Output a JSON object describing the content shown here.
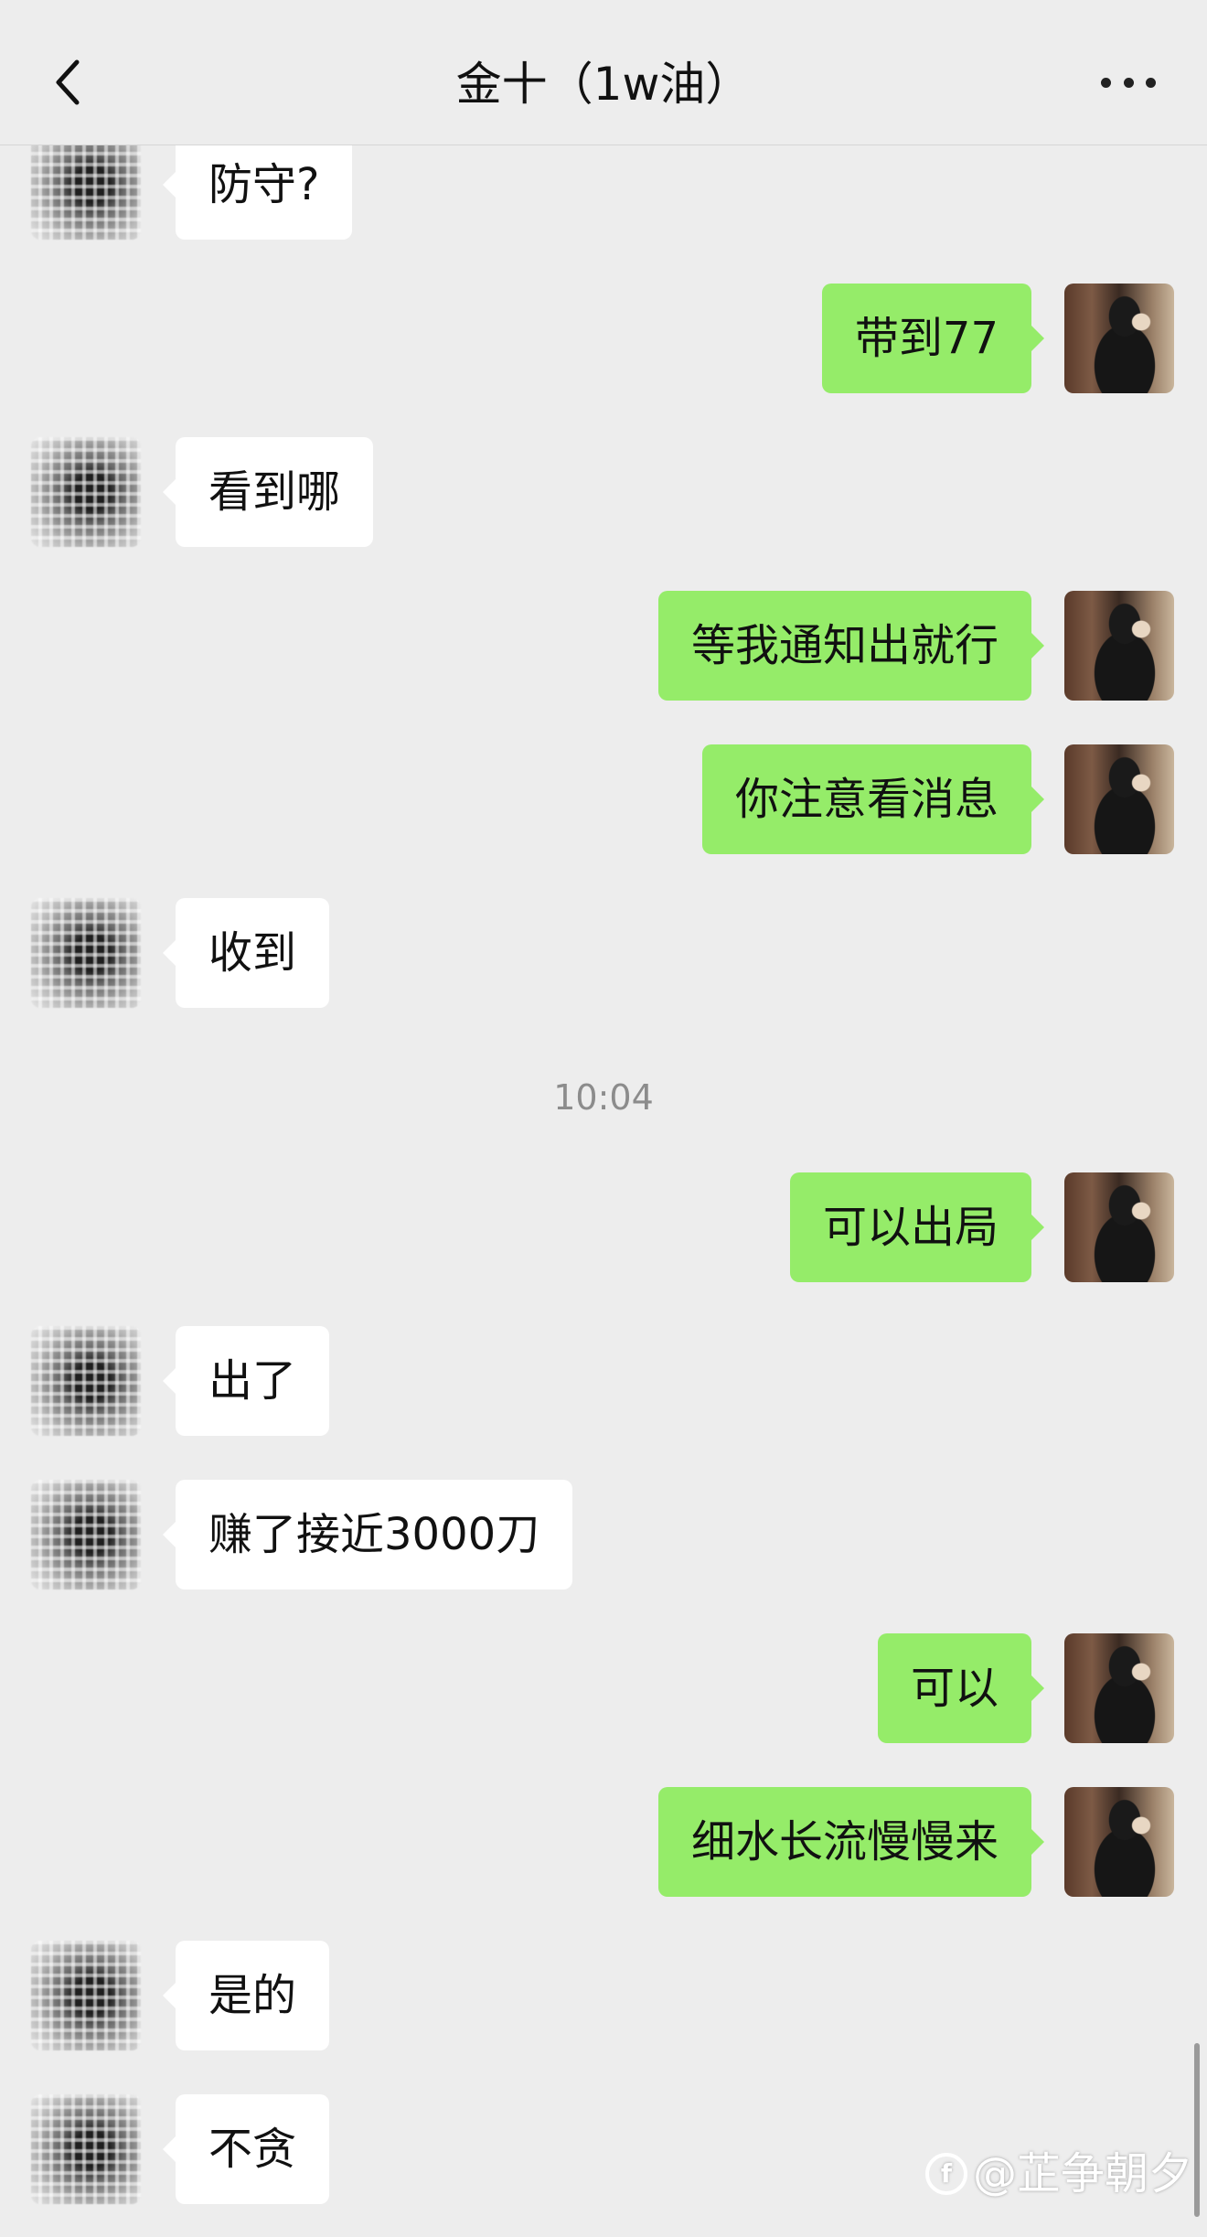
{
  "header": {
    "title": "金十（1w油）",
    "back_icon": "chevron-left-icon",
    "more_icon": "more-dots-icon"
  },
  "messages": [
    {
      "side": "in",
      "text": "防守?"
    },
    {
      "side": "out",
      "text": "带到77"
    },
    {
      "side": "in",
      "text": "看到哪"
    },
    {
      "side": "out",
      "text": "等我通知出就行"
    },
    {
      "side": "out",
      "text": "你注意看消息"
    },
    {
      "side": "in",
      "text": "收到"
    },
    {
      "side": "out",
      "text": "可以出局"
    },
    {
      "side": "in",
      "text": "出了"
    },
    {
      "side": "in",
      "text": "赚了接近3000刀"
    },
    {
      "side": "out",
      "text": "可以"
    },
    {
      "side": "out",
      "text": "细水长流慢慢来"
    },
    {
      "side": "in",
      "text": "是的"
    },
    {
      "side": "in",
      "text": "不贪"
    }
  ],
  "timestamp": "10:04",
  "watermark": "@芷争朝夕",
  "colors": {
    "background": "#ededed",
    "bubble_in": "#ffffff",
    "bubble_out": "#95ec69",
    "timestamp": "#8c8c8c"
  }
}
